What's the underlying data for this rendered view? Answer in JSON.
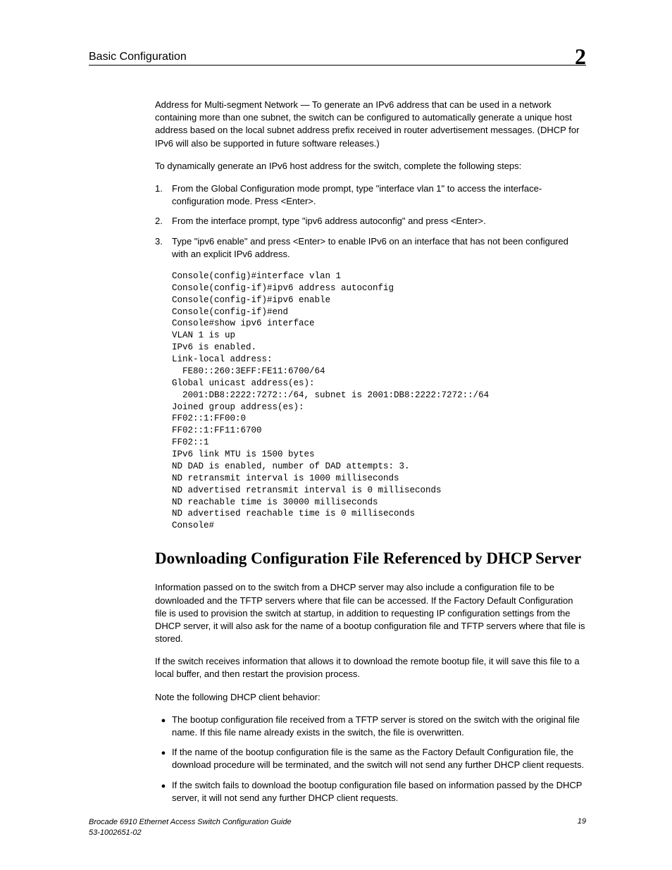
{
  "header": {
    "title": "Basic Configuration",
    "chapter": "2"
  },
  "intro": {
    "p1": "Address for Multi-segment Network — To generate an IPv6 address that can be used in a network containing more than one subnet, the switch can be configured to automatically generate a unique host address based on the local subnet address prefix received in router advertisement messages. (DHCP for IPv6 will also be supported in future software releases.)",
    "p2": "To dynamically generate an IPv6 host address for the switch, complete the following steps:"
  },
  "steps": [
    "From the Global Configuration mode prompt, type \"interface vlan 1\" to access the interface-configuration mode. Press <Enter>.",
    "From the interface prompt, type \"ipv6 address autoconfig\" and press <Enter>.",
    "Type \"ipv6 enable\" and press <Enter> to enable IPv6 on an interface that has not been configured with an explicit IPv6 address."
  ],
  "code": "Console(config)#interface vlan 1\nConsole(config-if)#ipv6 address autoconfig\nConsole(config-if)#ipv6 enable\nConsole(config-if)#end\nConsole#show ipv6 interface\nVLAN 1 is up\nIPv6 is enabled.\nLink-local address:\n  FE80::260:3EFF:FE11:6700/64\nGlobal unicast address(es):\n  2001:DB8:2222:7272::/64, subnet is 2001:DB8:2222:7272::/64\nJoined group address(es):\nFF02::1:FF00:0\nFF02::1:FF11:6700\nFF02::1\nIPv6 link MTU is 1500 bytes\nND DAD is enabled, number of DAD attempts: 3.\nND retransmit interval is 1000 milliseconds\nND advertised retransmit interval is 0 milliseconds\nND reachable time is 30000 milliseconds\nND advertised reachable time is 0 milliseconds\nConsole#",
  "section": {
    "heading": "Downloading Configuration File Referenced by DHCP Server",
    "p1": "Information passed on to the switch from a DHCP server may also include a configuration file to be downloaded and the TFTP servers where that file can be accessed. If the Factory Default Configuration file is used to provision the switch at startup, in addition to requesting IP configuration settings from the DHCP server, it will also ask for the name of a bootup configuration file and TFTP servers where that file is stored.",
    "p2": "If the switch receives information that allows it to download the remote bootup file, it will save this file to a local buffer, and then restart the provision process.",
    "p3": "Note the following DHCP client behavior:"
  },
  "bullets": [
    "The bootup configuration file received from a TFTP server is stored on the switch with the original file name. If this file name already exists in the switch, the file is overwritten.",
    "If the name of the bootup configuration file is the same as the Factory Default Configuration file, the download procedure will be terminated, and the switch will not send any further DHCP client requests.",
    "If the switch fails to download the bootup configuration file based on information passed by the DHCP server, it will not send any further DHCP client requests."
  ],
  "footer": {
    "line1": "Brocade 6910 Ethernet Access Switch Configuration Guide",
    "line2": "53-1002651-02",
    "page": "19"
  }
}
